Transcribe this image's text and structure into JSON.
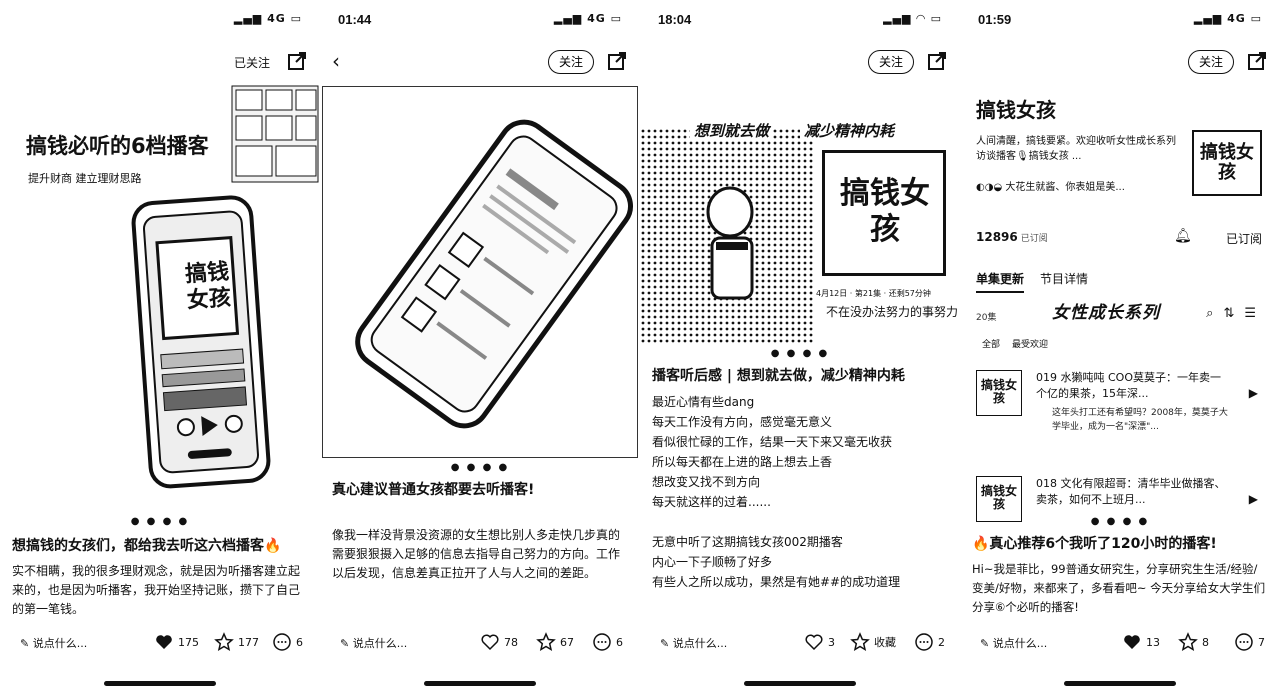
{
  "panels": [
    {
      "status": {
        "time": "",
        "signal": "4G"
      },
      "follow": "已关注",
      "hero": {
        "title": "搞钱必听的6档播客",
        "subtitle": "提升财商 建立理财思路",
        "brand": "搞钱女孩"
      },
      "post_title": "想搞钱的女孩们，都给我去听这六档播客🔥",
      "post_body": "实不相瞒，我的很多理财观念，就是因为听播客建立起来的，也是因为听播客，我开始坚持记账，攒下了自己的第一笔钱。",
      "comment_placeholder": "说点什么...",
      "likes": "175",
      "stars": "177",
      "comments": "6"
    },
    {
      "status": {
        "time": "01:44",
        "signal": "4G"
      },
      "follow": "关注",
      "post_title": "真心建议普通女孩都要去听播客!",
      "post_body": "像我一样没背景没资源的女生想比别人多走快几步真的需要狠狠摄入足够的信息去指导自己努力的方向。工作以后发现，信息差真正拉开了人与人之间的差距。",
      "comment_placeholder": "说点什么...",
      "likes": "78",
      "stars": "67",
      "comments": "6"
    },
    {
      "status": {
        "time": "18:04",
        "signal": ""
      },
      "follow": "关注",
      "hero": {
        "left_caption": "想到就去做",
        "right_caption": "减少精神内耗",
        "brand": "搞钱女孩",
        "episode_meta": "4月12日 · 第21集 · 还剩57分钟",
        "episode_caption": "不在没办法努力的事努力"
      },
      "post_title": "播客听后感 | 想到就去做，减少精神内耗",
      "post_lines": [
        "最近心情有些dang",
        "每天工作没有方向，感觉毫无意义",
        "看似很忙碌的工作，结果一天下来又毫无收获",
        "所以每天都在上进的路上想去上香",
        "想改变又找不到方向",
        "每天就这样的过着......",
        "",
        "无意中听了这期搞钱女孩002期播客",
        "内心一下子顺畅了好多",
        "有些人之所以成功，果然是有她##的成功道理"
      ],
      "comment_placeholder": "说点什么...",
      "likes": "3",
      "stars": "收藏",
      "comments": "2"
    },
    {
      "status": {
        "time": "01:59",
        "signal": "4G"
      },
      "follow": "关注",
      "podcast": {
        "title": "搞钱女孩",
        "desc": "人间清醒，搞钱要紧。欢迎收听女性成长系列访谈播客🎙搞钱女孩 ...",
        "hosts": "大花生就酱、你表姐是美...",
        "cover": "搞钱女孩",
        "subscribers": "12896",
        "subscribers_label": "已订阅",
        "subscribed": "已订阅",
        "tabs": [
          "单集更新",
          "节目详情"
        ],
        "banner": "女性成长系列",
        "count_label": "20集",
        "filters": [
          "全部",
          "最受欢迎"
        ],
        "episodes": [
          {
            "title": "019 水獭吨吨 COO莫莫子：一年卖一个亿的果茶，15年深...",
            "desc": "这年头打工还有希望吗？2008年，莫莫子大学毕业，成为一名\"深漂\"...",
            "cover": "搞钱女孩"
          },
          {
            "title": "018 文化有限超哥：清华毕业做播客、卖茶，如何不上班月...",
            "desc": "",
            "cover": "搞钱女孩"
          }
        ]
      },
      "post_title": "🔥真心推荐6个我听了120小时的播客!",
      "post_body": "Hi~我是菲比，99普通女研究生，分享研究生生活/经验/变美/好物，来都来了，多看看吧~ 今天分享给女大学生们分享⑥个必听的播客!",
      "comment_placeholder": "说点什么...",
      "likes": "13",
      "stars": "8",
      "comments": "7"
    }
  ]
}
